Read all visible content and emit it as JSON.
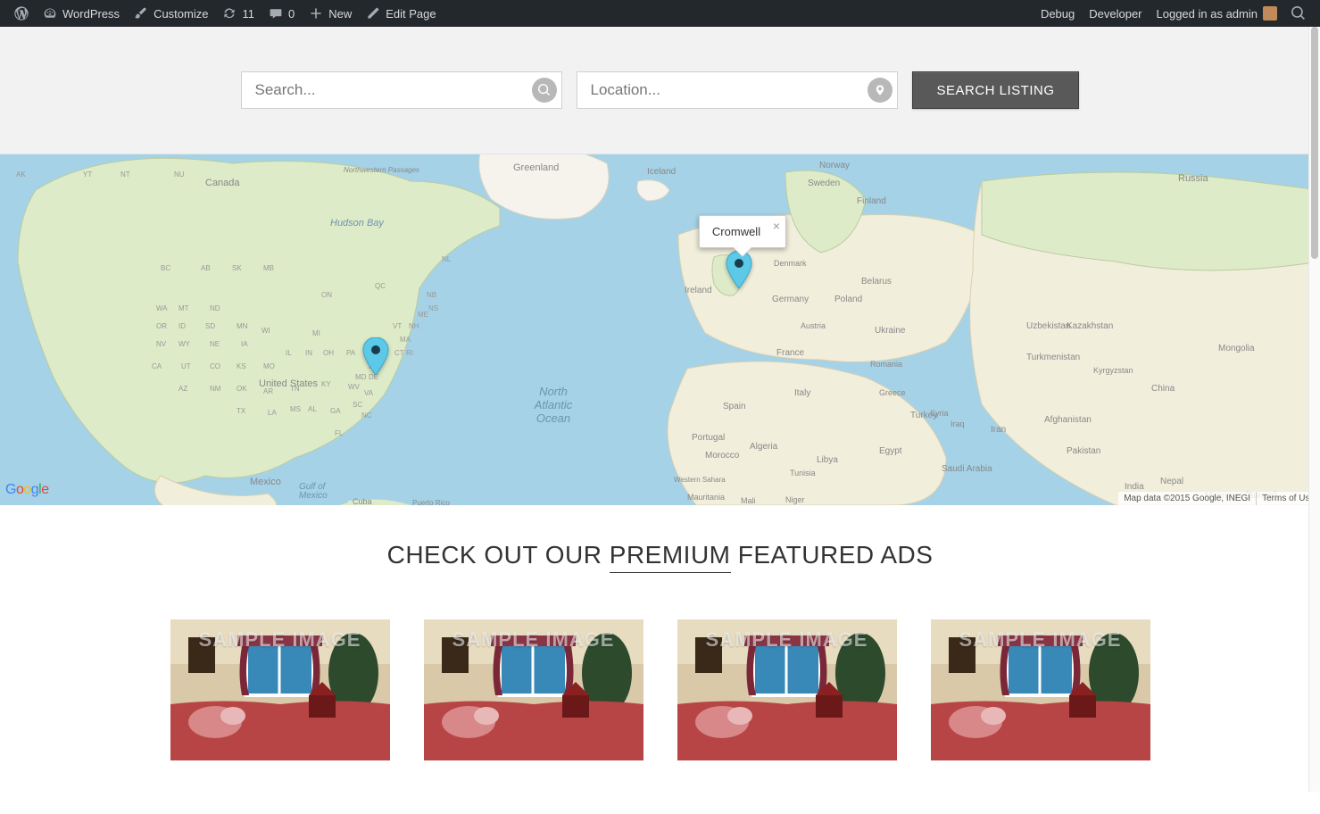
{
  "adminbar": {
    "wordpress": "WordPress",
    "customize": "Customize",
    "updates_count": "11",
    "comments_count": "0",
    "new": "New",
    "edit_page": "Edit Page",
    "debug": "Debug",
    "developer": "Developer",
    "logged_in": "Logged in as admin"
  },
  "search": {
    "keyword_placeholder": "Search...",
    "location_placeholder": "Location...",
    "button_label": "SEARCH LISTING"
  },
  "map": {
    "infowindow_label": "Cromwell",
    "attribution_data": "Map data ©2015 Google, INEGI",
    "attribution_terms": "Terms of Use",
    "google_logo": "Google"
  },
  "featured": {
    "heading_pre": "CHECK OUT OUR ",
    "heading_mid": "PREMIUM",
    "heading_post": " FEATURED ADS",
    "watermark": "SAMPLE IMAGE"
  }
}
